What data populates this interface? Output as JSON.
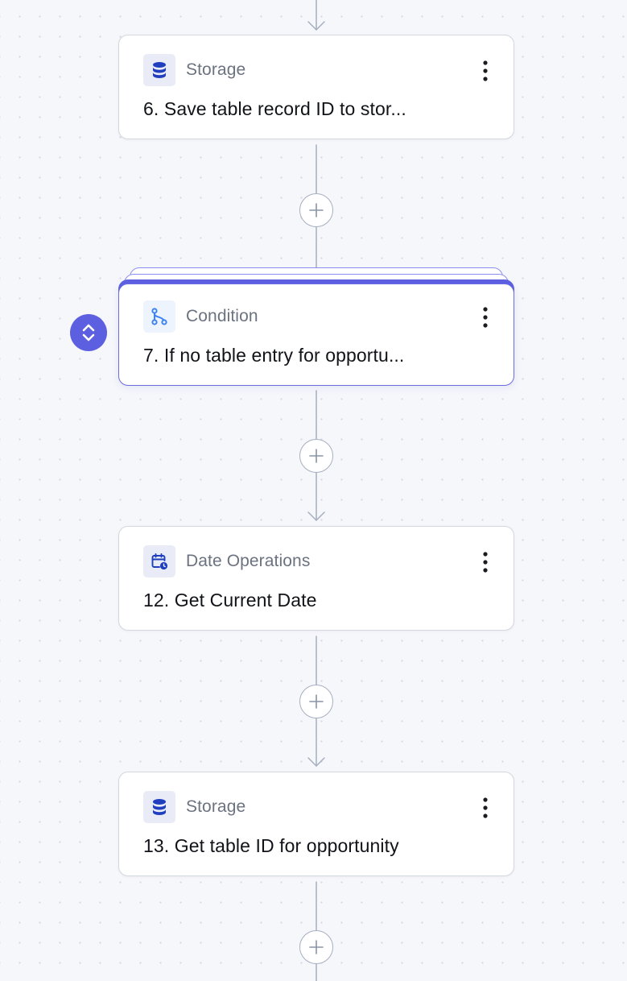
{
  "workflow": {
    "steps": [
      {
        "type_label": "Storage",
        "title": "6. Save table record ID to stor...",
        "icon": "database-icon"
      },
      {
        "type_label": "Condition",
        "title": "7. If no table entry for opportu...",
        "icon": "branch-icon"
      },
      {
        "type_label": "Date Operations",
        "title": "12. Get Current Date",
        "icon": "calendar-clock-icon"
      },
      {
        "type_label": "Storage",
        "title": "13. Get table ID for opportunity",
        "icon": "database-icon"
      }
    ],
    "colors": {
      "accent": "#5b5fe0",
      "storage_icon": "#1f3fbf",
      "condition_icon": "#3b82f6",
      "connector": "#a6afc0"
    }
  }
}
